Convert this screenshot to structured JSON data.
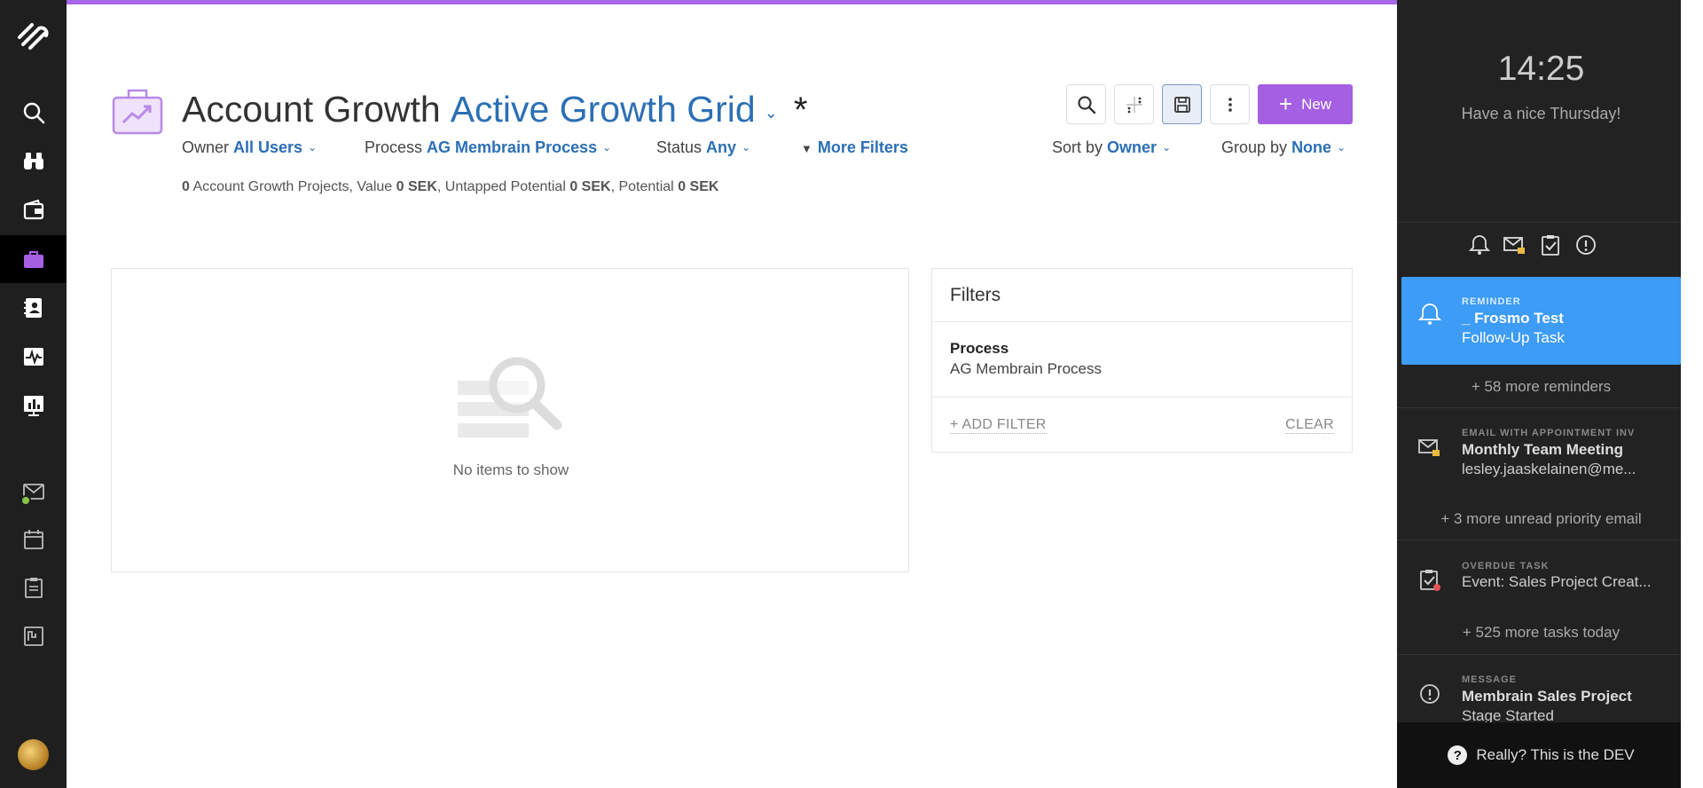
{
  "header": {
    "title_entity": "Account Growth",
    "title_view": "Active Growth Grid",
    "unsaved_marker": "*",
    "new_button_label": "New"
  },
  "filters_bar": {
    "owner": {
      "label": "Owner",
      "value": "All Users"
    },
    "process": {
      "label": "Process",
      "value": "AG Membrain Process"
    },
    "status": {
      "label": "Status",
      "value": "Any"
    },
    "more_filters": "More Filters",
    "sort": {
      "label": "Sort by",
      "value": "Owner"
    },
    "group": {
      "label": "Group by",
      "value": "None"
    }
  },
  "summary": {
    "count": "0",
    "projects_label": "Account Growth Projects, Value",
    "value": "0 SEK",
    "untapped_label": ", Untapped Potential",
    "untapped": "0 SEK",
    "potential_label": ", Potential",
    "potential": "0 SEK"
  },
  "empty_state": {
    "text": "No items to show"
  },
  "filters_panel": {
    "title": "Filters",
    "items": [
      {
        "key": "Process",
        "value": "AG Membrain Process"
      }
    ],
    "add_filter": "+ ADD FILTER",
    "clear": "CLEAR"
  },
  "right_panel": {
    "clock": "14:25",
    "greeting": "Have a nice Thursday!",
    "notifications": [
      {
        "type": "REMINDER",
        "line1": "_ Frosmo Test",
        "line2": "Follow-Up Task",
        "icon": "bell-icon",
        "highlight": true
      },
      {
        "type": "EMAIL WITH APPOINTMENT INV",
        "line1": "Monthly Team Meeting",
        "line2": "lesley.jaaskelainen@me...",
        "icon": "mail-lock-icon"
      },
      {
        "type": "OVERDUE TASK",
        "line1": "Event: Sales Project Creat...",
        "line2": "",
        "icon": "task-overdue-icon"
      },
      {
        "type": "MESSAGE",
        "line1": "Membrain Sales Project",
        "line2": "Stage Started",
        "icon": "info-icon"
      }
    ],
    "more_reminders": "+ 58 more reminders",
    "more_emails": "+ 3 more unread priority email",
    "more_tasks": "+ 525 more tasks today",
    "footer": "Really? This is the DEV"
  },
  "colors": {
    "accent": "#a55fe3",
    "link": "#2c6fb5",
    "highlight": "#3d9cf5"
  }
}
